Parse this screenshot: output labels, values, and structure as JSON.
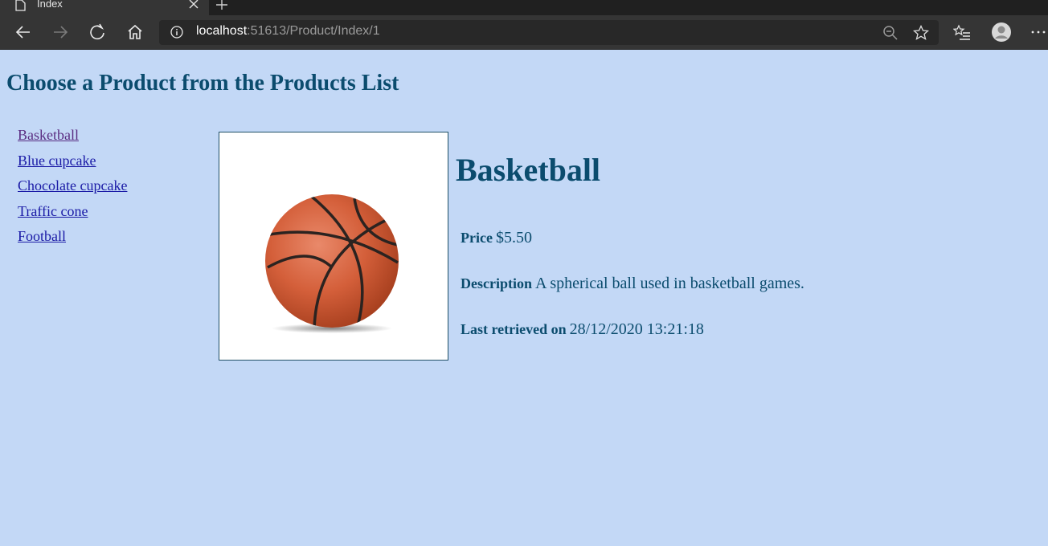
{
  "browser": {
    "tab_title": "Index",
    "url_host": "localhost",
    "url_path": ":51613/Product/Index/1"
  },
  "page": {
    "title": "Choose a Product from the Products List",
    "products": [
      "Basketball",
      "Blue cupcake",
      "Chocolate cupcake",
      "Traffic cone",
      "Football"
    ],
    "selected": {
      "name": "Basketball",
      "price_label": "Price",
      "price": "$5.50",
      "description_label": "Description",
      "description": "A spherical ball used in basketball games.",
      "retrieved_label": "Last retrieved on",
      "retrieved": "28/12/2020 13:21:18"
    }
  },
  "icons": {
    "back": "arrow-left-icon",
    "forward": "arrow-right-icon",
    "refresh": "refresh-icon",
    "home": "home-icon",
    "info": "info-icon",
    "zoom": "zoom-out-icon",
    "favorite": "star-icon",
    "favorites": "favorites-list-icon",
    "profile": "profile-icon",
    "menu": "more-icon"
  },
  "colors": {
    "page_background": "#c3d8f6",
    "heading": "#0b4c6e",
    "link": "#1a1aa6",
    "visited_link": "#5a2d82"
  }
}
